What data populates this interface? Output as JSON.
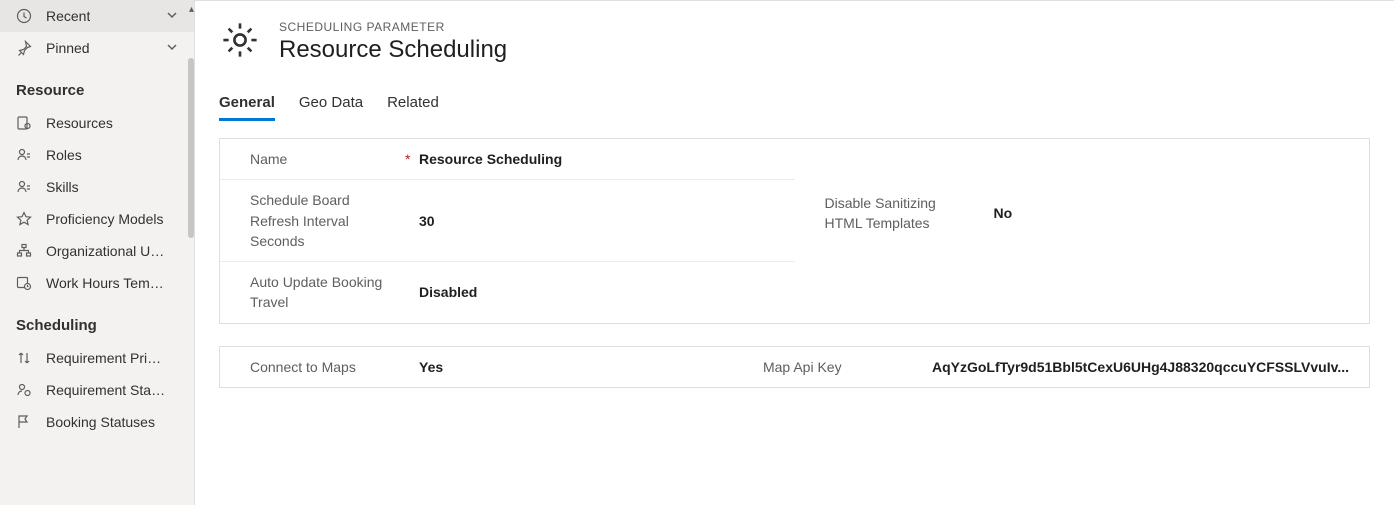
{
  "sidebar": {
    "recent_label": "Recent",
    "pinned_label": "Pinned",
    "groups": [
      {
        "title": "Resource",
        "items": [
          "Resources",
          "Roles",
          "Skills",
          "Proficiency Models",
          "Organizational Un...",
          "Work Hours Templ..."
        ]
      },
      {
        "title": "Scheduling",
        "items": [
          "Requirement Prior...",
          "Requirement Stat...",
          "Booking Statuses"
        ]
      }
    ]
  },
  "header": {
    "eyebrow": "SCHEDULING PARAMETER",
    "title": "Resource Scheduling"
  },
  "tabs": [
    "General",
    "Geo Data",
    "Related"
  ],
  "active_tab": "General",
  "section1": {
    "name_label": "Name",
    "name_value": "Resource Scheduling",
    "refresh_label": "Schedule Board Refresh Interval Seconds",
    "refresh_value": "30",
    "sanitize_label": "Disable Sanitizing HTML Templates",
    "sanitize_value": "No",
    "travel_label": "Auto Update Booking Travel",
    "travel_value": "Disabled"
  },
  "section2": {
    "connect_label": "Connect to Maps",
    "connect_value": "Yes",
    "mapkey_label": "Map Api Key",
    "mapkey_value": "AqYzGoLfTyr9d51Bbl5tCexU6UHg4J88320qccuYCFSSLVvuIv..."
  }
}
